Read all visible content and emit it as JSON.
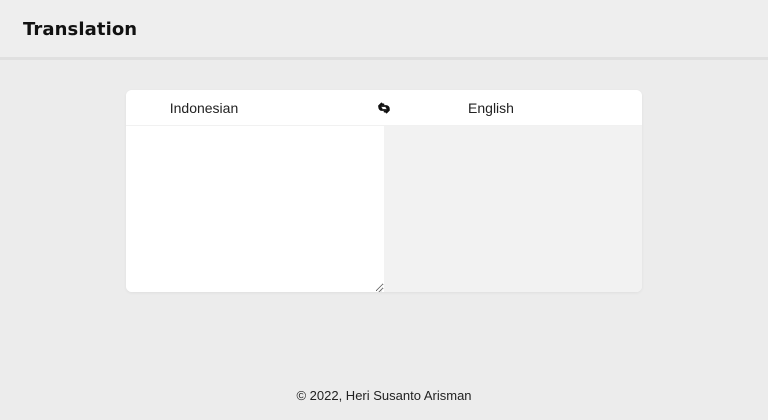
{
  "header": {
    "title": "Translation"
  },
  "translator": {
    "source_language": "Indonesian",
    "target_language": "English",
    "swap_icon": "swap-arrows-icon",
    "source_text": "",
    "target_text": ""
  },
  "footer": {
    "copyright": "© 2022, Heri Susanto Arisman"
  },
  "colors": {
    "page_background": "#ececec",
    "card_background": "#ffffff",
    "output_background": "#f2f2f2"
  }
}
